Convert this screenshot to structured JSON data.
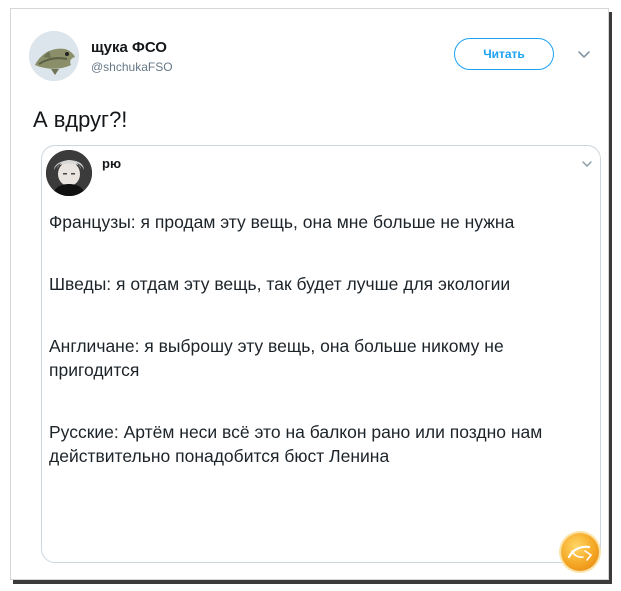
{
  "tweet": {
    "author": {
      "display_name": "щука ФСО",
      "handle": "@shchukaFSO"
    },
    "follow_label": "Читать",
    "text": "А вдруг?!"
  },
  "quoted": {
    "author_name": "рю",
    "paragraphs": [
      "Французы: я продам эту вещь, она мне больше не нужна",
      "Шведы: я отдам эту вещь, так будет лучше для экологии",
      "Англичане: я выброшу эту вещь, она больше никому не пригодится",
      "Русские:  Артём неси всё это на балкон рано или поздно нам действительно понадобится бюст Ленина"
    ]
  },
  "watermark_text": "Щука",
  "colors": {
    "accent": "#1da1f2",
    "text": "#14171a",
    "muted": "#657786",
    "border": "#ccd6dd",
    "watermark": "#f5a623"
  },
  "icons": {
    "menu": "chevron-down-icon",
    "quoted_menu": "chevron-down-icon"
  }
}
